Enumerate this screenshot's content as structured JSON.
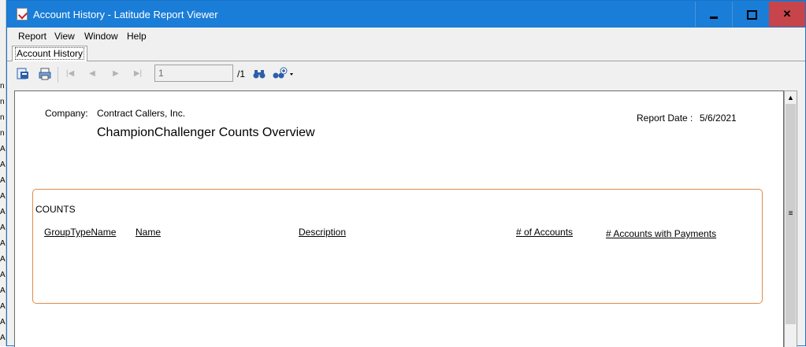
{
  "window": {
    "title": "Account History - Latitude Report Viewer"
  },
  "menu": {
    "items": [
      "Report",
      "View",
      "Window",
      "Help"
    ]
  },
  "tabs": {
    "active": "Account History"
  },
  "toolbar": {
    "page_value": "1",
    "page_total": "/1"
  },
  "report": {
    "company_label": "Company:",
    "company_name": "Contract Callers, Inc.",
    "report_title": "ChampionChallenger Counts Overview",
    "date_label": "Report Date :",
    "date_value": "5/6/2021",
    "section_title": "COUNTS",
    "columns": [
      "GroupTypeName",
      "Name",
      "Description",
      "# of Accounts",
      "# Accounts with Payments"
    ]
  },
  "background_strip": {
    "letters": [
      "n",
      "n",
      "n",
      "n",
      "A",
      "A",
      "A",
      "A",
      "A",
      "A",
      "A",
      "A",
      "A",
      "A",
      "A",
      "A",
      "A",
      "A"
    ]
  }
}
